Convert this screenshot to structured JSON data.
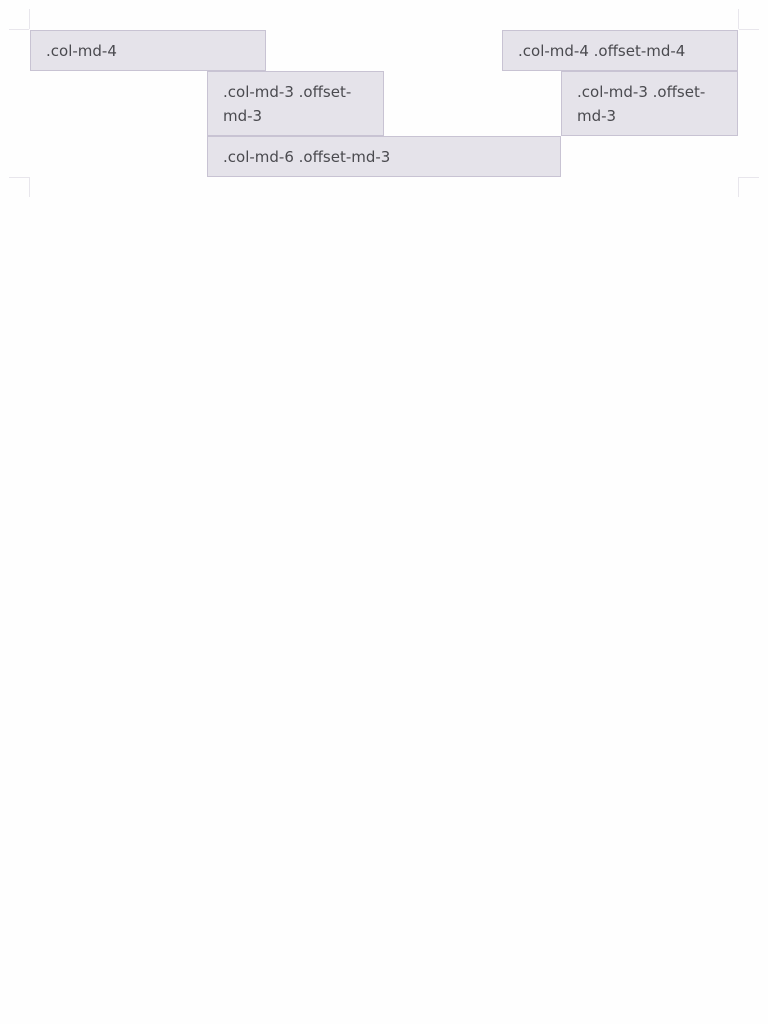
{
  "grid": {
    "row1": {
      "first_label": ".col-md-4",
      "second_label": ".col-md-4 .offset-md-4"
    },
    "row2": {
      "first_label": ".col-md-3 .offset-md-3",
      "second_label": ".col-md-3 .offset-md-3"
    },
    "row3": {
      "label": ".col-md-6 .offset-md-3"
    }
  }
}
